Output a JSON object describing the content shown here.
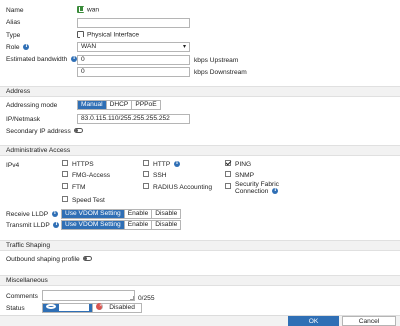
{
  "general": {
    "name_label": "Name",
    "name_value": "wan",
    "alias_label": "Alias",
    "alias_value": "",
    "type_label": "Type",
    "type_value": "Physical Interface",
    "role_label": "Role",
    "role_value": "WAN",
    "bandwidth_label": "Estimated bandwidth",
    "upstream_value": "0",
    "upstream_unit": "kbps Upstream",
    "downstream_value": "0",
    "downstream_unit": "kbps Downstream"
  },
  "address": {
    "section_title": "Address",
    "mode_label": "Addressing mode",
    "modes": [
      "Manual",
      "DHCP",
      "PPPoE"
    ],
    "ip_label": "IP/Netmask",
    "ip_value": "83.0.115.110/255.255.255.252",
    "secondary_label": "Secondary IP address"
  },
  "access": {
    "section_title": "Administrative Access",
    "ipv4_label": "IPv4",
    "options": {
      "https": "HTTPS",
      "http": "HTTP",
      "ping": "PING",
      "fmg": "FMG-Access",
      "ssh": "SSH",
      "snmp": "SNMP",
      "ftm": "FTM",
      "radius": "RADIUS Accounting",
      "fabric_line1": "Security Fabric",
      "fabric_line2": "Connection",
      "speed": "Speed Test"
    },
    "receive_lldp_label": "Receive LLDP",
    "transmit_lldp_label": "Transmit LLDP",
    "lldp_options": [
      "Use VDOM Setting",
      "Enable",
      "Disable"
    ]
  },
  "shaping": {
    "section_title": "Traffic Shaping",
    "outbound_label": "Outbound shaping profile"
  },
  "misc": {
    "section_title": "Miscellaneous",
    "comments_label": "Comments",
    "comments_counter": "0/255",
    "status_label": "Status",
    "enabled_label": "Enabled",
    "disabled_label": "Disabled"
  },
  "footer": {
    "ok_label": "OK",
    "cancel_label": "Cancel"
  },
  "colors": {
    "accent": "#2f6fb5",
    "disabled_red": "#d9534f",
    "net_icon": "#3a8b3a"
  }
}
